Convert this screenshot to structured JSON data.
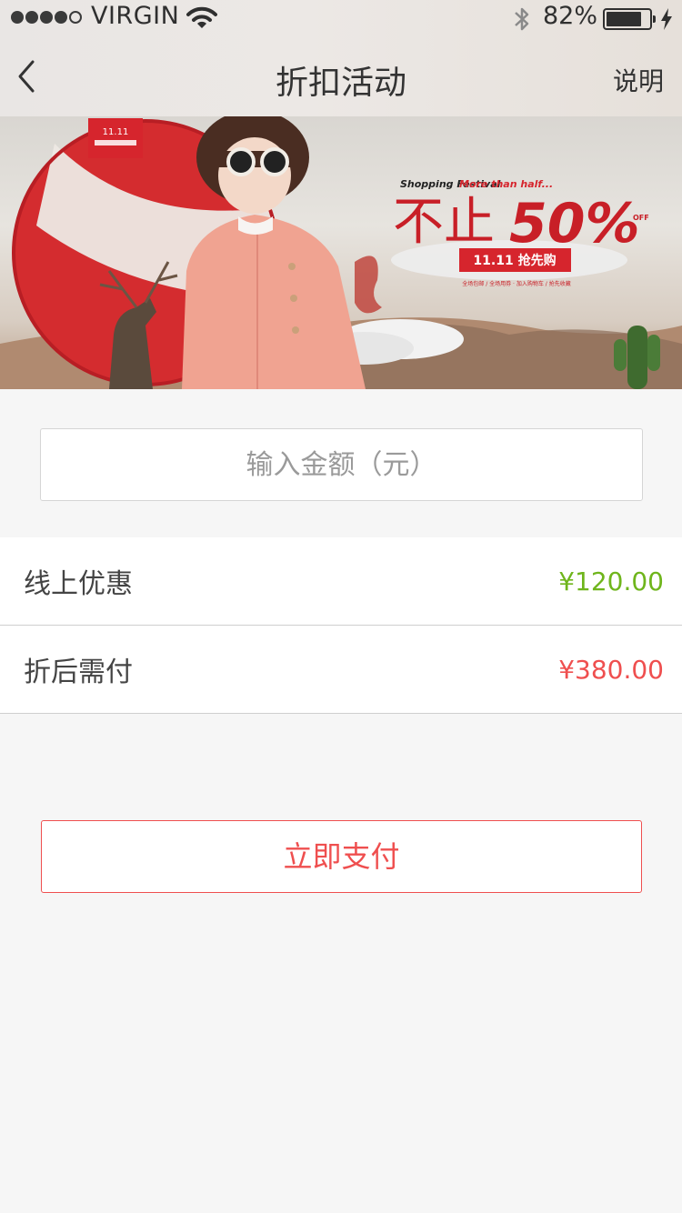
{
  "status_bar": {
    "carrier": "VIRGIN",
    "battery_percent": "82%",
    "battery_level": 0.82,
    "signal_bars": 4
  },
  "nav": {
    "title": "折扣活动",
    "right_label": "说明"
  },
  "banner": {
    "badge": "11.11",
    "tagline_en": "Shopping Festival",
    "tagline_accent": "More than half...",
    "headline_cn": "不止",
    "headline_big": "50%",
    "headline_small": "OFF",
    "sub_button": "11.11 抢先购",
    "footnote": "全场包邮 / 全场用券 · 加入购物车 / 抢先收藏",
    "accent_color": "#d6252d"
  },
  "amount_input": {
    "placeholder": "输入金额（元）",
    "value": ""
  },
  "rows": [
    {
      "label": "线上优惠",
      "value": "¥120.00",
      "color": "#6fb51c"
    },
    {
      "label": "折后需付",
      "value": "¥380.00",
      "color": "#ef4f4f"
    }
  ],
  "pay_button": {
    "label": "立即支付"
  },
  "colors": {
    "accent_red": "#ef4f4f",
    "accent_green": "#6fb51c",
    "background": "#f6f6f6"
  }
}
